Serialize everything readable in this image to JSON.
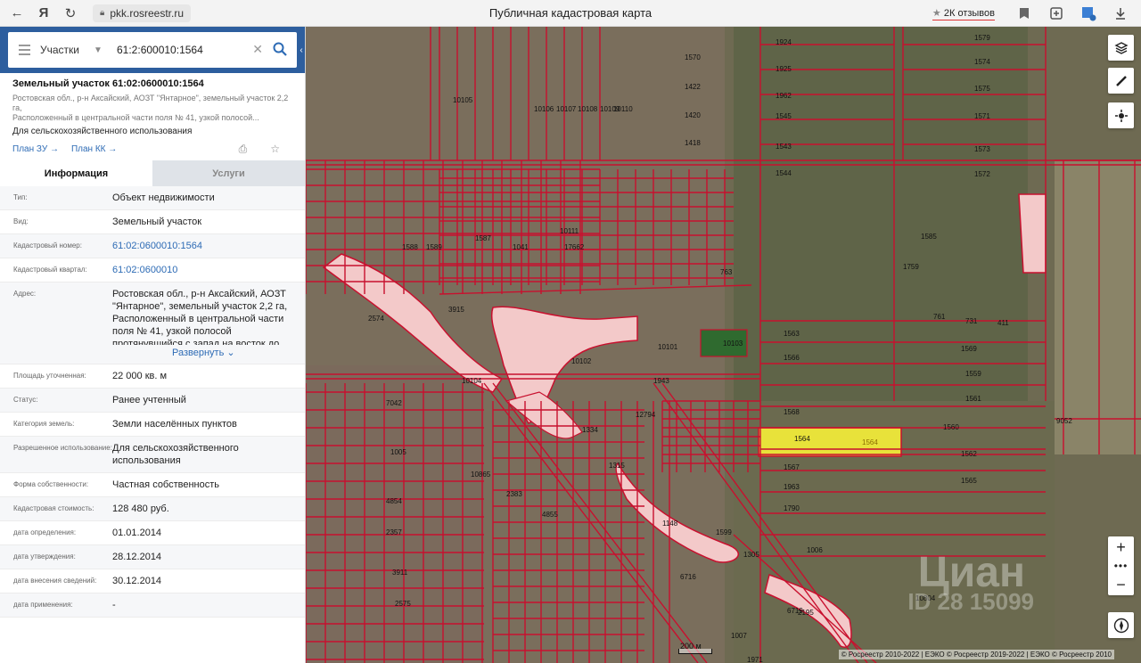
{
  "browser": {
    "url": "pkk.rosreestr.ru",
    "title": "Публичная кадастровая карта",
    "reviews": "2К отзывов"
  },
  "search": {
    "type": "Участки",
    "value": "61:2:600010:1564"
  },
  "object": {
    "title": "Земельный участок 61:02:0600010:1564",
    "address_short_1": "Ростовская обл., р-н Аксайский, АОЗТ \"Янтарное\", земельный участок 2,2 га,",
    "address_short_2": "Расположенный в центральной части поля № 41, узкой полосой...",
    "use": "Для сельскохозяйственного использования",
    "plan_zu": "План ЗУ →",
    "plan_kk": "План КК →"
  },
  "tabs": {
    "info": "Информация",
    "services": "Услуги"
  },
  "attrs": {
    "type_k": "Тип:",
    "type_v": "Объект недвижимости",
    "kind_k": "Вид:",
    "kind_v": "Земельный участок",
    "cad_k": "Кадастровый номер:",
    "cad_v": "61:02:0600010:1564",
    "quarter_k": "Кадастровый квартал:",
    "quarter_v": "61:02:0600010",
    "addr_k": "Адрес:",
    "addr_v": "Ростовская обл., р-н Аксайский, АОЗТ \"Янтарное\", земельный участок 2,2 га, Расположенный в центральной части поля № 41, узкой полосой протянувшийся с запад на восток до",
    "expand": "Развернуть",
    "area_k": "Площадь уточненная:",
    "area_v": "22 000 кв. м",
    "status_k": "Статус:",
    "status_v": "Ранее учтенный",
    "cat_k": "Категория земель:",
    "cat_v": "Земли населённых пунктов",
    "perm_k": "Разрешенное использование:",
    "perm_v": "Для сельскохозяйственного использования",
    "own_k": "Форма собственности:",
    "own_v": "Частная собственность",
    "cost_k": "Кадастровая стоимость:",
    "cost_v": "128 480 руб.",
    "det_k": "дата определения:",
    "det_v": "01.01.2014",
    "appr_k": "дата утверждения:",
    "appr_v": "28.12.2014",
    "entry_k": "дата внесения сведений:",
    "entry_v": "30.12.2014",
    "apply_k": "дата применения:",
    "apply_v": "-"
  },
  "map": {
    "scale": "200 м",
    "copyright": "© Росреестр 2010-2022 | ЕЭКО © Росреестр 2019-2022 | ЕЭКО © Росреестр 2010",
    "watermark_1": "Циан",
    "watermark_2": "ID 28 15099",
    "parcel_labels": [
      "1570",
      "1422",
      "1420",
      "1418",
      "1924",
      "1925",
      "1962",
      "1545",
      "1543",
      "1544",
      "1579",
      "1574",
      "1575",
      "1571",
      "1573",
      "1572",
      "1585",
      "1759",
      "1563",
      "1566",
      "1568",
      "1564",
      "1567",
      "1963",
      "1790",
      "1569",
      "1559",
      "1561",
      "1560",
      "1562",
      "1565",
      "1006",
      "1007",
      "10804",
      "6719",
      "6716",
      "1599",
      "1305",
      "1315",
      "1334",
      "1148",
      "12794",
      "7042",
      "1005",
      "10865",
      "2383",
      "4855",
      "4854",
      "2357",
      "3911",
      "2575",
      "2574",
      "3915",
      "1943",
      "10101",
      "10102",
      "10103",
      "10104",
      "10105",
      "10106",
      "10107",
      "10108",
      "10109",
      "10110",
      "10111",
      "1041",
      "17662",
      "763",
      "761",
      "731",
      "411",
      "9052",
      "2195",
      "1971",
      "1587",
      "1589",
      "1588"
    ],
    "selected_label": "1564"
  },
  "colors": {
    "panel_header": "#2d5e9e",
    "link": "#2d6bb5",
    "parcel_line": "#c8102e",
    "selected_fill": "#e8e23a"
  },
  "icons": [
    "back-arrow-icon",
    "yandex-icon",
    "reload-icon",
    "lock-icon",
    "star-icon",
    "bookmark-icon",
    "extension-icon",
    "download-icon",
    "menu-icon",
    "chevron-down-icon",
    "clear-icon",
    "search-icon",
    "layers-icon",
    "ruler-icon",
    "locate-icon",
    "zoom-in-icon",
    "zoom-out-icon",
    "compass-icon",
    "favorite-icon",
    "print-icon"
  ]
}
